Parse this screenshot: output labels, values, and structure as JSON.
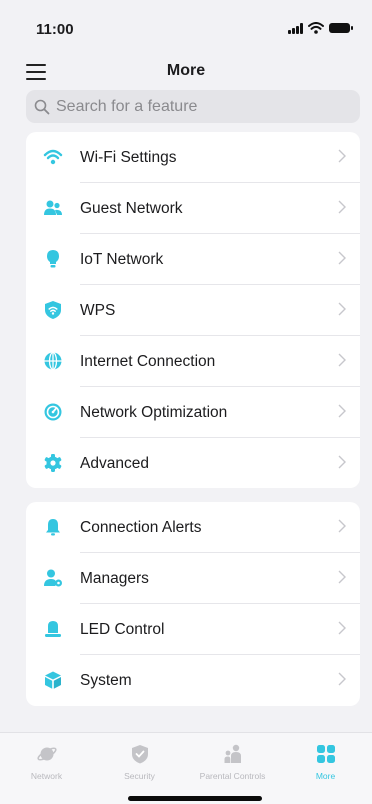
{
  "status_bar": {
    "time": "11:00"
  },
  "header": {
    "title": "More"
  },
  "search": {
    "placeholder": "Search for a feature"
  },
  "section1": {
    "items": [
      {
        "label": "Wi-Fi Settings",
        "icon": "wifi-icon"
      },
      {
        "label": "Guest Network",
        "icon": "guest-users-icon"
      },
      {
        "label": "IoT Network",
        "icon": "lightbulb-icon"
      },
      {
        "label": "WPS",
        "icon": "wps-shield-icon"
      },
      {
        "label": "Internet Connection",
        "icon": "globe-icon"
      },
      {
        "label": "Network Optimization",
        "icon": "optimization-icon"
      },
      {
        "label": "Advanced",
        "icon": "gear-icon"
      }
    ]
  },
  "section2": {
    "items": [
      {
        "label": "Connection Alerts",
        "icon": "bell-icon"
      },
      {
        "label": "Managers",
        "icon": "manager-user-icon"
      },
      {
        "label": "LED Control",
        "icon": "led-icon"
      },
      {
        "label": "System",
        "icon": "system-box-icon"
      }
    ]
  },
  "tabbar": {
    "tabs": [
      {
        "label": "Network",
        "icon": "network-planet-icon",
        "active": false
      },
      {
        "label": "Security",
        "icon": "security-shield-icon",
        "active": false
      },
      {
        "label": "Parental Controls",
        "icon": "family-icon",
        "active": false
      },
      {
        "label": "More",
        "icon": "grid-icon",
        "active": true
      }
    ]
  },
  "colors": {
    "accent": "#34c6e0",
    "inactive": "#c4c4c8",
    "background": "#f2f2f5"
  }
}
